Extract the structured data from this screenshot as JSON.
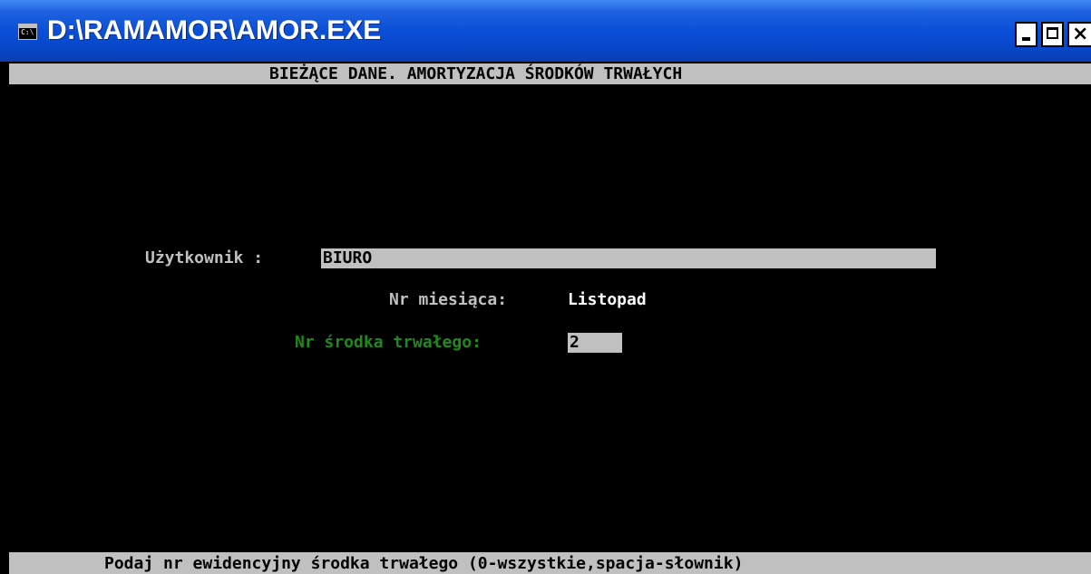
{
  "window": {
    "title": "D:\\RAMAMOR\\AMOR.EXE",
    "icon": "console-window-icon",
    "icon_glyph": "C:\\",
    "buttons": {
      "minimize": "minimize-icon",
      "maximize": "maximize-icon",
      "close": "close-icon",
      "close_glyph": "×"
    }
  },
  "console": {
    "header": "BIEŻĄCE DANE. AMORTYZACJA ŚRODKÓW TRWAŁYCH",
    "user": {
      "label": "Użytkownik :",
      "value": "BIURO"
    },
    "month": {
      "label": "Nr miesiąca:",
      "value": "Listopad"
    },
    "asset": {
      "label": "Nr środka trwałego:",
      "value": "2"
    },
    "status": "Podaj nr ewidencyjny środka trwałego (0-wszystkie,spacja-słownik)"
  },
  "colors": {
    "titlebar": "#0a4fd8",
    "console_bg": "#000000",
    "bar_gray": "#c0c0c0",
    "label_gray": "#c0c0c0",
    "value_white": "#ffffff",
    "active_green": "#1e8a1e"
  }
}
